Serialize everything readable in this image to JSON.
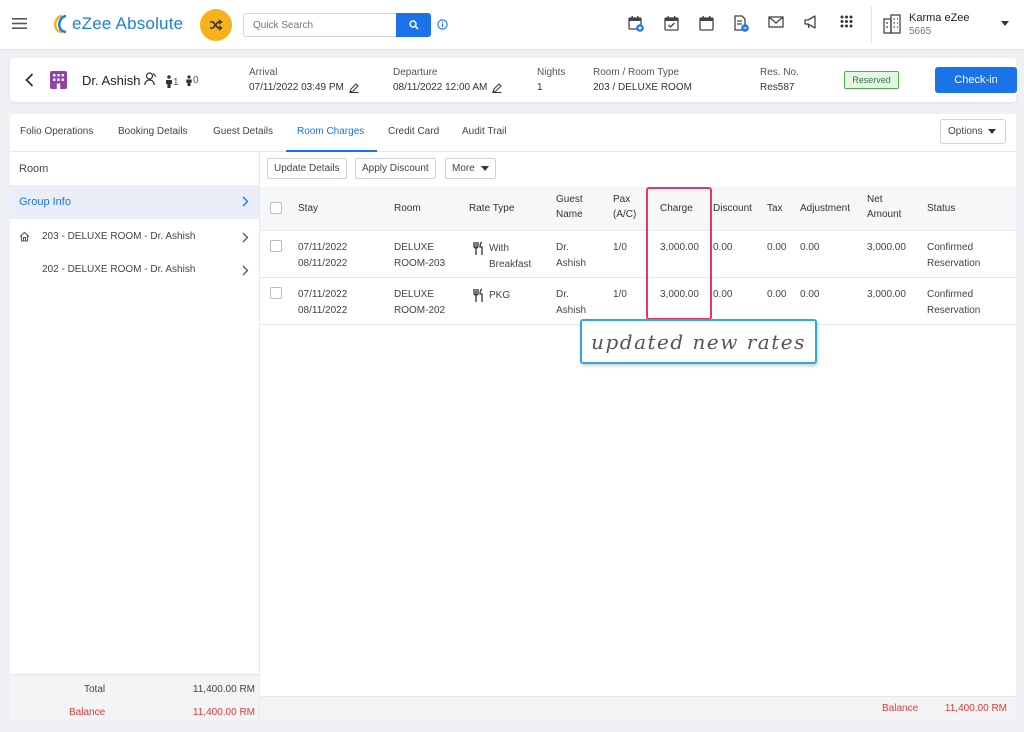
{
  "header": {
    "app_name": "eZee Absolute",
    "search_placeholder": "Quick Search",
    "property_name": "Karma eZee",
    "property_code": "5665",
    "tool_icons": [
      "calendar-plus-icon",
      "calendar-check-icon",
      "calendar-icon",
      "document-icon",
      "mail-icon",
      "megaphone-icon",
      "apps-grid-icon"
    ]
  },
  "reservation": {
    "guest_name": "Dr. Ashish",
    "adults": "1",
    "children": "0",
    "arrival_label": "Arrival",
    "arrival_value": "07/11/2022 03:49 PM",
    "departure_label": "Departure",
    "departure_value": "08/11/2022 12:00 AM",
    "nights_label": "Nights",
    "nights_value": "1",
    "room_label": "Room / Room Type",
    "room_value": "203 / DELUXE ROOM",
    "resno_label": "Res. No.",
    "resno_value": "Res587",
    "status": "Reserved",
    "checkin_label": "Check-in"
  },
  "tabs": [
    "Folio Operations",
    "Booking Details",
    "Guest Details",
    "Room Charges",
    "Credit Card",
    "Audit Trail"
  ],
  "active_tab": "Room Charges",
  "options_label": "Options",
  "sidebar": {
    "header": "Room",
    "group_label": "Group Info",
    "rooms": [
      "203 - DELUXE ROOM - Dr. Ashish",
      "202 - DELUXE ROOM - Dr. Ashish"
    ],
    "total_label": "Total",
    "total_value": "11,400.00 RM",
    "balance_label": "Balance",
    "balance_value": "11,400.00 RM"
  },
  "toolbar": {
    "update_label": "Update Details",
    "discount_label": "Apply Discount",
    "more_label": "More"
  },
  "table": {
    "headers": {
      "stay": "Stay",
      "room": "Room",
      "rate_type": "Rate Type",
      "guest_name_1": "Guest",
      "guest_name_2": "Name",
      "pax_1": "Pax",
      "pax_2": "(A/C)",
      "charge": "Charge",
      "discount": "Discount",
      "tax": "Tax",
      "adjustment": "Adjustment",
      "net_amount_1": "Net",
      "net_amount_2": "Amount",
      "status": "Status"
    },
    "rows": [
      {
        "stay_from": "07/11/2022",
        "stay_to": "08/11/2022",
        "room_1": "DELUXE",
        "room_2": "ROOM-203",
        "rate_1": "With",
        "rate_2": "Breakfast",
        "guest_1": "Dr.",
        "guest_2": "Ashish",
        "pax": "1/0",
        "charge": "3,000.00",
        "discount": "0.00",
        "tax": "0.00",
        "adjustment": "0.00",
        "net": "3,000.00",
        "status_1": "Confirmed",
        "status_2": "Reservation"
      },
      {
        "stay_from": "07/11/2022",
        "stay_to": "08/11/2022",
        "room_1": "DELUXE",
        "room_2": "ROOM-202",
        "rate_1": "PKG",
        "rate_2": "",
        "guest_1": "Dr.",
        "guest_2": "Ashish",
        "pax": "1/0",
        "charge": "3,000.00",
        "discount": "0.00",
        "tax": "0.00",
        "adjustment": "0.00",
        "net": "3,000.00",
        "status_1": "Confirmed",
        "status_2": "Reservation"
      }
    ],
    "balance_label": "Balance",
    "balance_value": "11,400.00 RM"
  },
  "annotation": "updated new rates",
  "colors": {
    "accent": "#1a73e8",
    "shuffle": "#f5b21a",
    "balance": "#e53935",
    "highlight": "#e8366d",
    "callout": "#29abe2"
  }
}
